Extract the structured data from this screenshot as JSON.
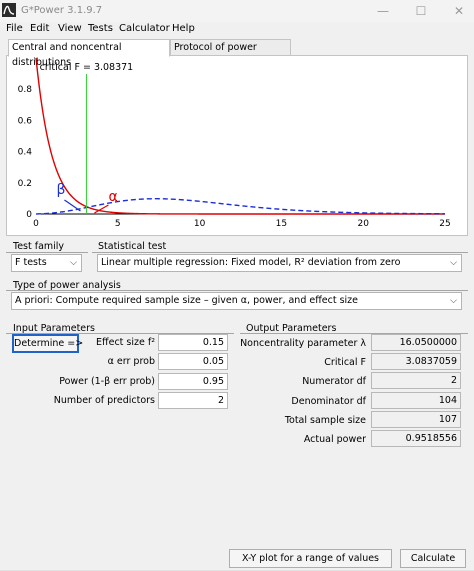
{
  "window": {
    "title": "G*Power 3.1.9.7",
    "minimize": "—",
    "maximize": "☐",
    "close": "✕"
  },
  "menu": [
    "File",
    "Edit",
    "View",
    "Tests",
    "Calculator",
    "Help"
  ],
  "tabs": [
    {
      "label": "Central and noncentral distributions",
      "active": true
    },
    {
      "label": "Protocol of power analyses",
      "active": false
    }
  ],
  "chart_data": {
    "type": "line",
    "annotation": "critical F = 3.08371",
    "critical_value": 3.08371,
    "xlim": [
      0,
      25
    ],
    "ylim": [
      0,
      1
    ],
    "x_ticks": [
      0,
      5,
      10,
      15,
      20,
      25
    ],
    "y_ticks": [
      0,
      0.2,
      0.4,
      0.6,
      0.8
    ],
    "alpha_label": "α",
    "beta_label": "β",
    "series": [
      {
        "style": "solid",
        "color": "#e00000",
        "df1": 2,
        "df2": 104,
        "noncentrality": 0
      },
      {
        "style": "dashed",
        "color": "#1a2fd6",
        "df1": 2,
        "df2": 104,
        "noncentrality": 16.05
      }
    ],
    "critical_line_color": "#2fd12f"
  },
  "test_family": {
    "label": "Test family",
    "value": "F tests"
  },
  "statistical_test": {
    "label": "Statistical test",
    "value": "Linear multiple regression: Fixed model, R² deviation from zero"
  },
  "power_type": {
    "label": "Type of power analysis",
    "value": "A priori: Compute required sample size – given α, power, and effect size"
  },
  "input": {
    "title": "Input Parameters",
    "determine_label": "Determine =>",
    "rows": [
      {
        "label": "Effect size f²",
        "value": "0.15"
      },
      {
        "label": "α err prob",
        "value": "0.05"
      },
      {
        "label": "Power (1-β err prob)",
        "value": "0.95"
      },
      {
        "label": "Number of predictors",
        "value": "2"
      }
    ]
  },
  "output": {
    "title": "Output Parameters",
    "rows": [
      {
        "label": "Noncentrality parameter λ",
        "value": "16.0500000"
      },
      {
        "label": "Critical F",
        "value": "3.0837059"
      },
      {
        "label": "Numerator df",
        "value": "2"
      },
      {
        "label": "Denominator df",
        "value": "104"
      },
      {
        "label": "Total sample size",
        "value": "107"
      },
      {
        "label": "Actual power",
        "value": "0.9518556"
      }
    ]
  },
  "buttons": {
    "xy_plot": "X-Y plot for a range of values",
    "calculate": "Calculate"
  }
}
